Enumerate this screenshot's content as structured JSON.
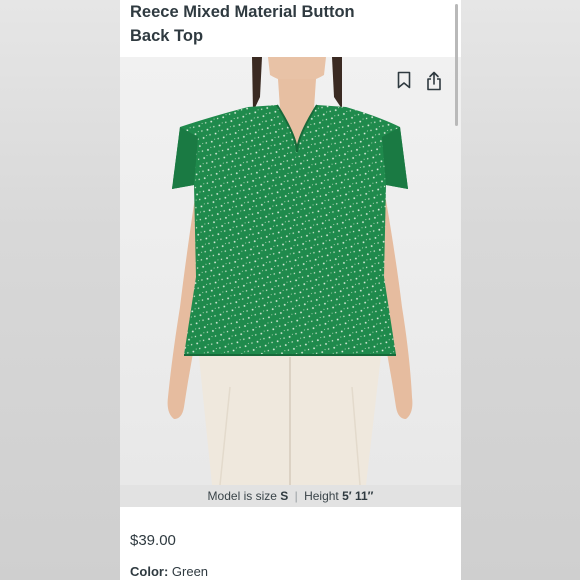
{
  "product": {
    "title_line1": "Reece Mixed Material Button",
    "title_line2": "Back Top",
    "price": "$39.00",
    "color_label": "Color:",
    "color_value": "Green"
  },
  "model_info": {
    "prefix": "Model is size",
    "size": "S",
    "separator": "|",
    "height_label": "Height",
    "height_value": "5′ 11″"
  },
  "carousel": {
    "total": 6,
    "active_index": 0
  },
  "icons": {
    "bookmark": "bookmark-icon",
    "share": "share-icon"
  },
  "colors": {
    "accent": "#1e7f7e",
    "top_green": "#1f8a4c",
    "text": "#2f3a40"
  }
}
